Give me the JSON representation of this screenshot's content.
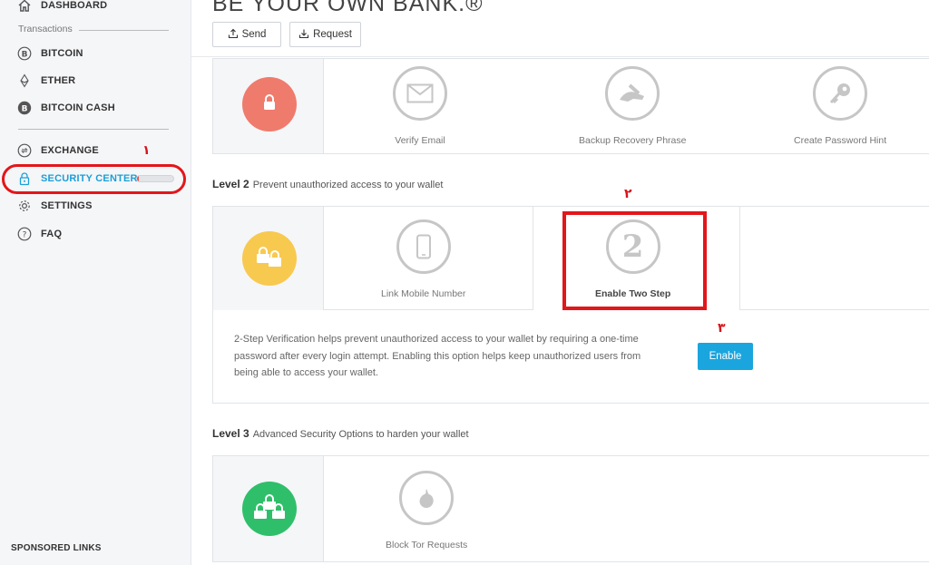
{
  "sidebar": {
    "dashboard": "DASHBOARD",
    "transactions_label": "Transactions",
    "bitcoin": "BITCOIN",
    "ether": "ETHER",
    "bitcoin_cash": "BITCOIN CASH",
    "exchange": "EXCHANGE",
    "security_center": "SECURITY CENTER",
    "security_progress": 0.05,
    "settings": "SETTINGS",
    "faq": "FAQ",
    "sponsored": "SPONSORED LINKS"
  },
  "header": {
    "headline": "BE YOUR OWN BANK.®",
    "send": "Send",
    "request": "Request"
  },
  "level1": {
    "steps": [
      "Verify Email",
      "Backup Recovery Phrase",
      "Create Password Hint"
    ]
  },
  "level2": {
    "title": "Level 2",
    "subtitle": "Prevent unauthorized access to your wallet",
    "steps": [
      "Link Mobile Number",
      "Enable Two Step"
    ],
    "two_step_digit": "2",
    "description": "2-Step Verification helps prevent unauthorized access to your wallet by requiring a one-time password after every login attempt. Enabling this option helps keep unauthorized users from being able to access your wallet.",
    "enable_label": "Enable"
  },
  "level3": {
    "title": "Level 3",
    "subtitle": "Advanced Security Options to harden your wallet",
    "steps": [
      "Block Tor Requests"
    ]
  },
  "annotations": {
    "one": "١",
    "two": "٢",
    "three": "٣"
  },
  "colors": {
    "accent": "#1ba5de",
    "level1_lock": "#ef7b6d",
    "level2_lock": "#f8c94f",
    "level3_lock": "#2fbf6a",
    "annotation": "#e3161b"
  },
  "icons": {
    "dashboard": "home-icon",
    "bitcoin": "bitcoin-icon",
    "ether": "ether-icon",
    "bitcoin_cash": "bitcoin-cash-icon",
    "exchange": "exchange-icon",
    "security": "lock-icon",
    "settings": "gear-icon",
    "faq": "question-icon"
  }
}
